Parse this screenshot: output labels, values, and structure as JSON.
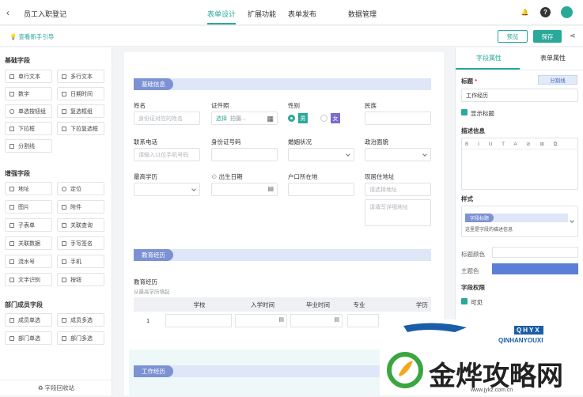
{
  "header": {
    "back_icon": "back-arrow-icon",
    "title": "员工入职登记",
    "tabs": [
      "表单设计",
      "扩展功能",
      "表单发布",
      "数据管理"
    ],
    "accent": "#2aa89a"
  },
  "subbar": {
    "guide": "查看新手引导",
    "preview": "预览",
    "save": "保存"
  },
  "left": {
    "basic_title": "基础字段",
    "basic": [
      "单行文本",
      "多行文本",
      "数字",
      "日期时间",
      "单选按钮组",
      "复选框组",
      "下拉框",
      "下拉复选框",
      "分割线"
    ],
    "enhanced_title": "增强字段",
    "enhanced": [
      "地址",
      "定位",
      "图片",
      "附件",
      "子表单",
      "关联查询",
      "关联数据",
      "手写签名",
      "流水号",
      "手机",
      "文字识别",
      "按钮"
    ],
    "dept_title": "部门成员字段",
    "dept": [
      "成员单选",
      "成员多选",
      "部门单选",
      "部门多选"
    ],
    "recycle": "字段回收站"
  },
  "form": {
    "sec_basic": "基础信息",
    "name_label": "姓名",
    "name_ph": "身份证对应的姓名",
    "photo_label": "证件照",
    "photo_select": "选择",
    "photo_hint": "拍摄...",
    "gender_label": "性别",
    "male": "男",
    "female": "女",
    "ethnic_label": "民族",
    "phone_label": "联系电话",
    "phone_ph": "请输入11位手机号码",
    "idno_label": "身份证号码",
    "marital_label": "婚姻状况",
    "political_label": "政治面貌",
    "edu_label": "最高学历",
    "birth_label": "出生日期",
    "hukou_label": "户口所在地",
    "addr_label": "现居住地址",
    "addr_ph": "请选择地址",
    "addr_detail_ph": "请填写详细地址",
    "sec_edu": "教育经历",
    "edu_table_label": "教育经历",
    "edu_table_hint": "从最高学历填起",
    "edu_cols": [
      "学校",
      "入学时间",
      "毕业时间",
      "专业",
      "学历"
    ],
    "row_no": "1",
    "sec_work": "工作经历"
  },
  "right": {
    "tab_field": "字段属性",
    "tab_form": "表单属性",
    "title_label": "标题",
    "required_mark": "*",
    "divider_btn": "分割线",
    "title_value": "工作经历",
    "show_title": "显示标题",
    "desc_label": "描述信息",
    "style_label": "样式",
    "style_tag": "字段标题",
    "style_desc": "这里是字段的描述信息",
    "title_color": "标题颜色",
    "theme_color": "主题色",
    "theme_hex": "#5b7fd6",
    "perm_label": "字段权限",
    "visible": "可见"
  },
  "watermark": {
    "brand": "QINHANYOUXI",
    "cn": "金烨攻略网",
    "url": "www.jykz.com.cn"
  }
}
